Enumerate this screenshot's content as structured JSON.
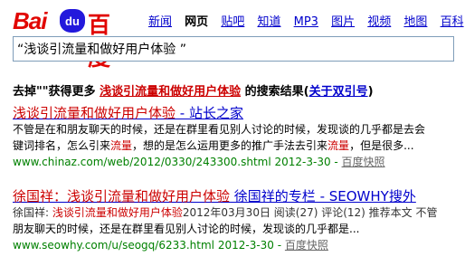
{
  "logo": {
    "bai": "Bai",
    "paw": "du",
    "cn": "百度"
  },
  "nav": [
    "新闻",
    "网页",
    "贴吧",
    "知道",
    "MP3",
    "图片",
    "视频",
    "地图",
    "百科"
  ],
  "nav_active": "网页",
  "search": {
    "value": "“浅谈引流量和做好用户体验 ”"
  },
  "tip": {
    "pre": "去掉\"\"获得更多",
    "query": "浅谈引流量和做好用户体验",
    "post": "的搜索结果(",
    "link": "关于双引号",
    "close": ")"
  },
  "results": [
    {
      "title_em": "浅谈引流量和做好用户体验",
      "title_rest": " - 站长之家",
      "snippet1": "不管是在和朋友聊天的时候，还是在群里看见别人讨论的时候，发现谈的几乎都是去会",
      "snippet2_a": "键词排名，怎么引来",
      "snippet2_em": "流量",
      "snippet2_b": "，想的是怎么运用更多的推广手法去引来",
      "snippet2_em2": "流量",
      "snippet2_c": "，但是很多...",
      "url": "www.chinaz.com/web/2012/0330/243300.shtml 2012-3-30 - ",
      "snapshot": "百度快照"
    },
    {
      "title_a": "徐国祥：",
      "title_em": "浅谈引流量和做好用户体验",
      "title_rest": " 徐国祥的专栏 - SEOWHY搜外",
      "meta_a": "徐国祥: ",
      "meta_em": "浅谈引流量和做好用户体验",
      "meta_b": "2012年03月30日  阅读(27) 评论(12) 推荐本文  不管",
      "snippet": "朋友聊天的时候，还是在群里看见别人讨论的时候，发现谈的几乎都是...",
      "url": "www.seowhy.com/u/seogq/6233.html 2012-3-30 - ",
      "snapshot": "百度快照"
    }
  ]
}
